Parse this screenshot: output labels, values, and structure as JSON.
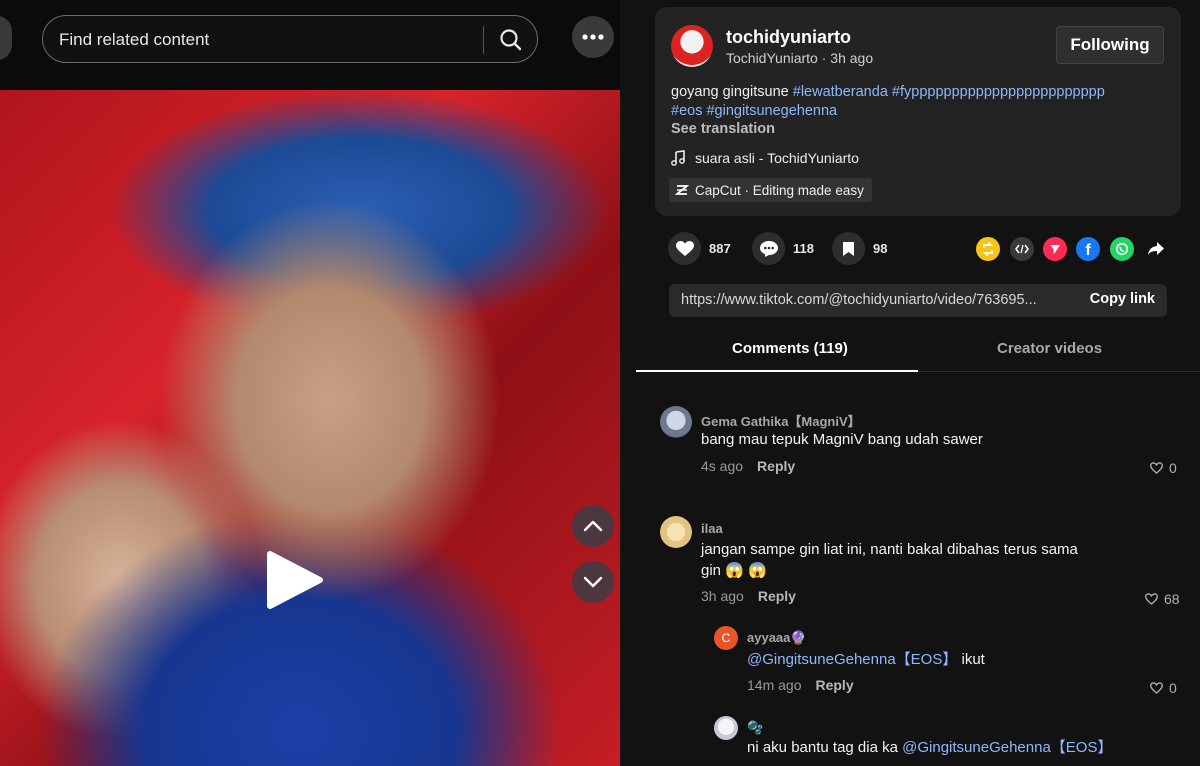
{
  "search": {
    "text": "Find related content"
  },
  "post": {
    "author_name": "tochidyuniarto",
    "author_handle": "TochidYuniarto",
    "time_ago": "3h ago",
    "follow_label": "Following",
    "caption_text": "goyang gingitsune ",
    "hashtags_line1": "#lewatberanda #fypppppppppppppppppppppppp",
    "hashtags_line2": "#eos #gingitsunegehenna",
    "see_translation": "See translation",
    "sound": "suara asli - TochidYuniarto",
    "capcut": "CapCut · Editing made easy"
  },
  "stats": {
    "likes": "887",
    "comments": "118",
    "saves": "98"
  },
  "share_icons": [
    "repost-icon",
    "embed-icon",
    "send-icon",
    "facebook-icon",
    "whatsapp-icon",
    "share-arrow-icon"
  ],
  "colors": {
    "repost": "#f5c518",
    "embed": "#3a3a3a",
    "send": "#fe2c55",
    "facebook": "#1877f2",
    "whatsapp": "#25d366",
    "hashtag": "#8fb8ff"
  },
  "link": {
    "url": "https://www.tiktok.com/@tochidyuniarto/video/763695...",
    "copy_label": "Copy link"
  },
  "tabs": {
    "comments": "Comments (119)",
    "creator_videos": "Creator videos"
  },
  "comments": [
    {
      "user": "Gema Gathika【MagniV】",
      "text": "bang mau tepuk MagniV bang udah sawer",
      "time": "4s ago",
      "reply": "Reply",
      "likes": "0"
    },
    {
      "user": "ilaa",
      "text_line1": "jangan sampe gin liat ini, nanti bakal dibahas terus sama",
      "text_line2": "gin 😱 😱",
      "time": "3h ago",
      "reply": "Reply",
      "likes": "68"
    }
  ],
  "replies": [
    {
      "user": "ayyaaa🔮",
      "mention": "@GingitsuneGehenna【EOS】",
      "text": " ikut",
      "time": "14m ago",
      "reply": "Reply",
      "likes": "0"
    },
    {
      "user": "🫧",
      "text": "ni aku bantu tag dia ka ",
      "mention": "@GingitsuneGehenna【EOS】"
    }
  ]
}
